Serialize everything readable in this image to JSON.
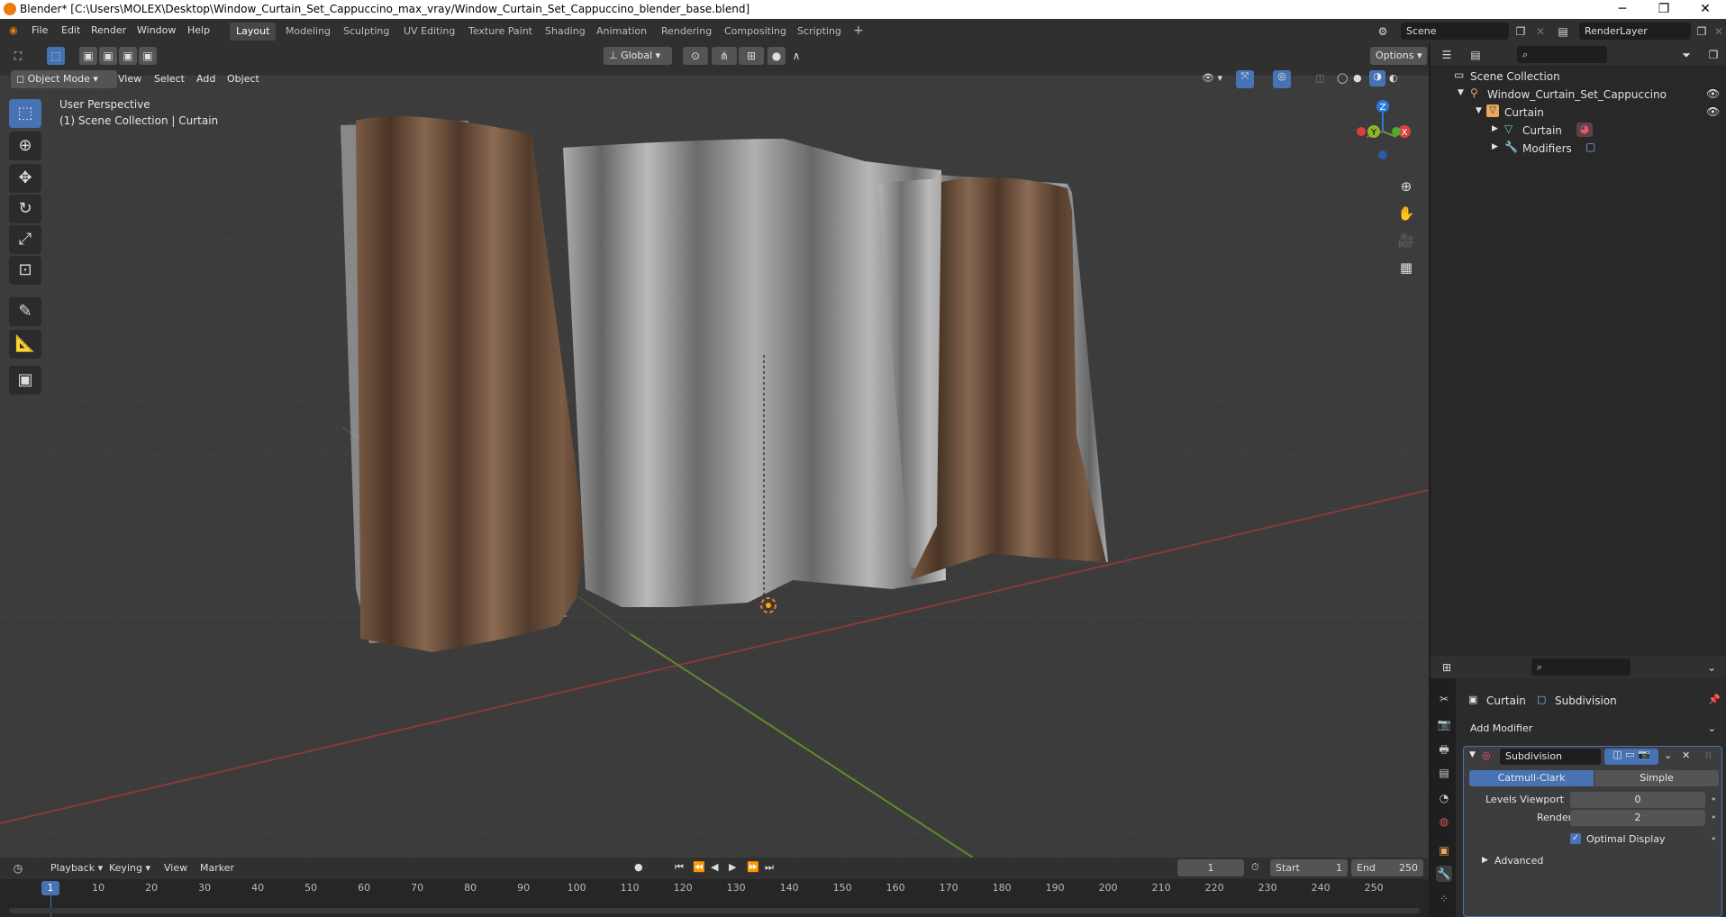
{
  "window": {
    "title": "Blender* [C:\\Users\\MOLEX\\Desktop\\Window_Curtain_Set_Cappuccino_max_vray/Window_Curtain_Set_Cappuccino_blender_base.blend]",
    "minimize": "─",
    "restore": "❐",
    "close": "✕"
  },
  "menus": [
    "File",
    "Edit",
    "Render",
    "Window",
    "Help"
  ],
  "workspaces": [
    "Layout",
    "Modeling",
    "Sculpting",
    "UV Editing",
    "Texture Paint",
    "Shading",
    "Animation",
    "Rendering",
    "Compositing",
    "Scripting"
  ],
  "scene": {
    "name": "Scene",
    "render_layer": "RenderLayer"
  },
  "viewport_header": {
    "mode": "Object Mode",
    "menus": [
      "View",
      "Select",
      "Add",
      "Object"
    ],
    "orientation": "Global",
    "options": "Options"
  },
  "viewport": {
    "line1": "User Perspective",
    "line2": "(1) Scene Collection | Curtain",
    "gizmo": {
      "z": "Z",
      "y": "Y",
      "x": "X"
    }
  },
  "timeline_header": {
    "menus": [
      "Playback",
      "Keying",
      "View",
      "Marker"
    ],
    "current_frame": "1",
    "start_label": "Start",
    "start": "1",
    "end_label": "End",
    "end": "250"
  },
  "timeline_ticks": [
    "1",
    "10",
    "20",
    "30",
    "40",
    "50",
    "60",
    "70",
    "80",
    "90",
    "100",
    "110",
    "120",
    "130",
    "140",
    "150",
    "160",
    "170",
    "180",
    "190",
    "200",
    "210",
    "220",
    "230",
    "240",
    "250"
  ],
  "outliner": {
    "root": "Scene Collection",
    "items": [
      {
        "label": "Window_Curtain_Set_Cappuccino",
        "indent": 0
      },
      {
        "label": "Curtain",
        "indent": 1
      },
      {
        "label": "Curtain",
        "indent": 2
      },
      {
        "label": "Modifiers",
        "indent": 2
      }
    ]
  },
  "properties": {
    "object": "Curtain",
    "modifier_crumb": "Subdivision",
    "add_modifier": "Add Modifier",
    "modifier_name": "Subdivision",
    "tab_catmull": "Catmull-Clark",
    "tab_simple": "Simple",
    "levels_viewport_label": "Levels Viewport",
    "levels_viewport": "0",
    "render_label": "Render",
    "render": "2",
    "optimal_display": "Optimal Display",
    "advanced": "Advanced"
  }
}
